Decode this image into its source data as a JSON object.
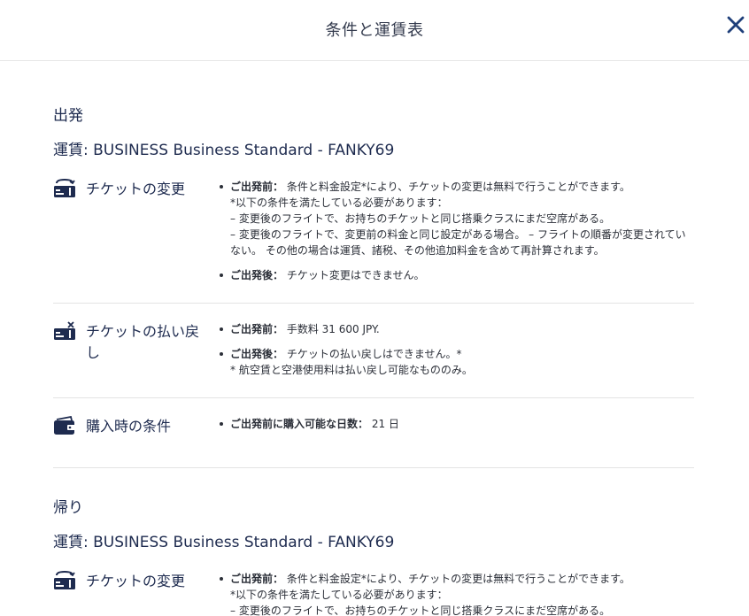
{
  "header": {
    "title": "条件と運賃表"
  },
  "sections": [
    {
      "heading": "出発",
      "fare": "運賃: BUSINESS Business Standard - FANKY69",
      "rules": [
        {
          "label": "チケットの変更",
          "icon": "ticket-change-icon",
          "bullets": [
            {
              "lead": "ご出発前：",
              "lines": [
                "条件と料金設定*により、チケットの変更は無料で行うことができます。",
                "*以下の条件を満たしている必要があります：",
                "– 変更後のフライトで、お持ちのチケットと同じ搭乗クラスにまだ空席がある。",
                "– 変更後のフライトで、変更前の料金と同じ設定がある場合。 – フライトの順番が変更されていない。 その他の場合は運賃、諸税、その他追加料金を含めて再計算されます。"
              ]
            },
            {
              "lead": "ご出発後：",
              "lines": [
                "チケット変更はできません。"
              ]
            }
          ]
        },
        {
          "label": "チケットの払い戻し",
          "icon": "ticket-refund-icon",
          "bullets": [
            {
              "lead": "ご出発前：",
              "lines": [
                "手数料 31 600 JPY."
              ]
            },
            {
              "lead": "ご出発後：",
              "lines": [
                "チケットの払い戻しはできません。*",
                "* 航空賃と空港使用料は払い戻し可能なもののみ。"
              ]
            }
          ]
        },
        {
          "label": "購入時の条件",
          "icon": "wallet-icon",
          "bullets": [
            {
              "lead": "ご出発前に購入可能な日数：",
              "lines": [
                "21 日"
              ]
            }
          ]
        }
      ]
    },
    {
      "heading": "帰り",
      "fare": "運賃: BUSINESS Business Standard - FANKY69",
      "rules": [
        {
          "label": "チケットの変更",
          "icon": "ticket-change-icon",
          "bullets": [
            {
              "lead": "ご出発前：",
              "lines": [
                "条件と料金設定*により、チケットの変更は無料で行うことができます。",
                "*以下の条件を満たしている必要があります：",
                "– 変更後のフライトで、お持ちのチケットと同じ搭乗クラスにまだ空席がある。"
              ]
            }
          ]
        }
      ]
    }
  ],
  "colors": {
    "primary": "#1e2b4f",
    "close": "#1f3f7a",
    "text": "#2b2f38",
    "divider": "#e3e3e3"
  }
}
